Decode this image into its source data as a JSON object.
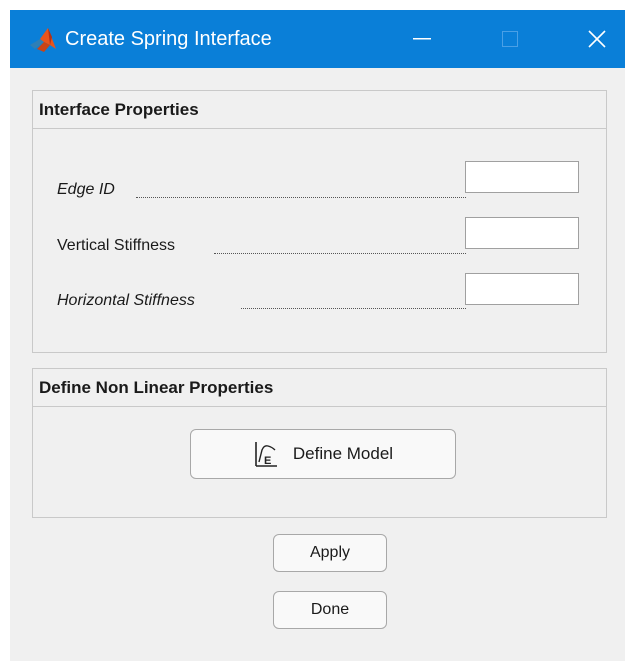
{
  "window": {
    "title": "Create Spring Interface",
    "app_icon": "matlab-logo-icon",
    "titlebar_color": "#0a7fd8"
  },
  "interface_properties": {
    "header": "Interface Properties",
    "fields": [
      {
        "label": "Edge ID",
        "value": ""
      },
      {
        "label": "Vertical Stiffness",
        "value": ""
      },
      {
        "label": "Horizontal Stiffness",
        "value": ""
      }
    ]
  },
  "nonlinear_properties": {
    "header": "Define Non Linear Properties",
    "define_model_label": "Define Model",
    "define_model_icon": "stress-strain-chart-icon"
  },
  "actions": {
    "apply_label": "Apply",
    "done_label": "Done"
  }
}
